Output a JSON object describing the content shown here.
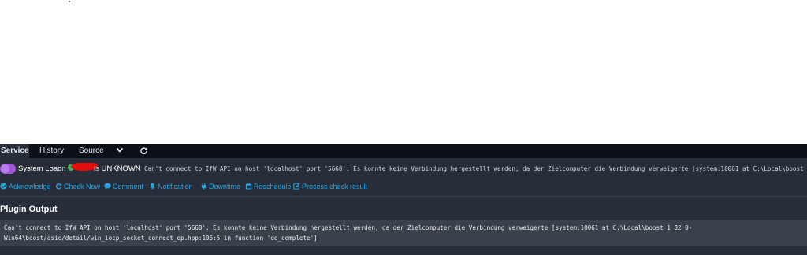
{
  "tabs": [
    {
      "label": "Service",
      "active": true
    },
    {
      "label": "History",
      "active": false
    },
    {
      "label": "Source",
      "active": false
    }
  ],
  "tab_icons": [
    "chevron-down-icon",
    "refresh-icon"
  ],
  "status": {
    "service_name": "System Load",
    "on_word": "on",
    "is_word": "is",
    "state": "UNKNOWN",
    "output": "Can't connect to IfW API on host 'localhost' port '5668': Es konnte keine Verbindung hergestellt werden, da der Zielcomputer die Verbindung verweigerte [system:10061 at C:\\Local\\boost_1_82_0-Win64\\boost/asio/detail/win_iocp_socket_connect_op.hpp:105:5 in function 'do_complete']"
  },
  "actions": [
    {
      "label": "Acknowledge",
      "icon": "check-circle-icon"
    },
    {
      "label": "Check Now",
      "icon": "refresh-icon"
    },
    {
      "label": "Comment",
      "icon": "comment-icon"
    },
    {
      "label": "Notification",
      "icon": "bell-icon"
    },
    {
      "label": "Downtime",
      "icon": "plug-icon"
    },
    {
      "label": "Reschedule",
      "icon": "calendar-icon"
    },
    {
      "label": "Process check result",
      "icon": "edit-icon"
    }
  ],
  "plugin_output": {
    "title": "Plugin Output",
    "text": "Can't connect to IfW API on host 'localhost' port '5668': Es konnte keine Verbindung hergestellt werden, da der Zielcomputer die Verbindung verweigerte [system:10061 at C:\\Local\\boost_1_82_0-\nWin64\\boost/asio/detail/win_iocp_socket_connect_op.hpp:105:5 in function 'do_complete']"
  },
  "colors": {
    "accent": "#28a5e3",
    "unknown_state": "#9f57d8",
    "panel_bg": "#282e39",
    "tabbar_bg": "#0c1119"
  }
}
